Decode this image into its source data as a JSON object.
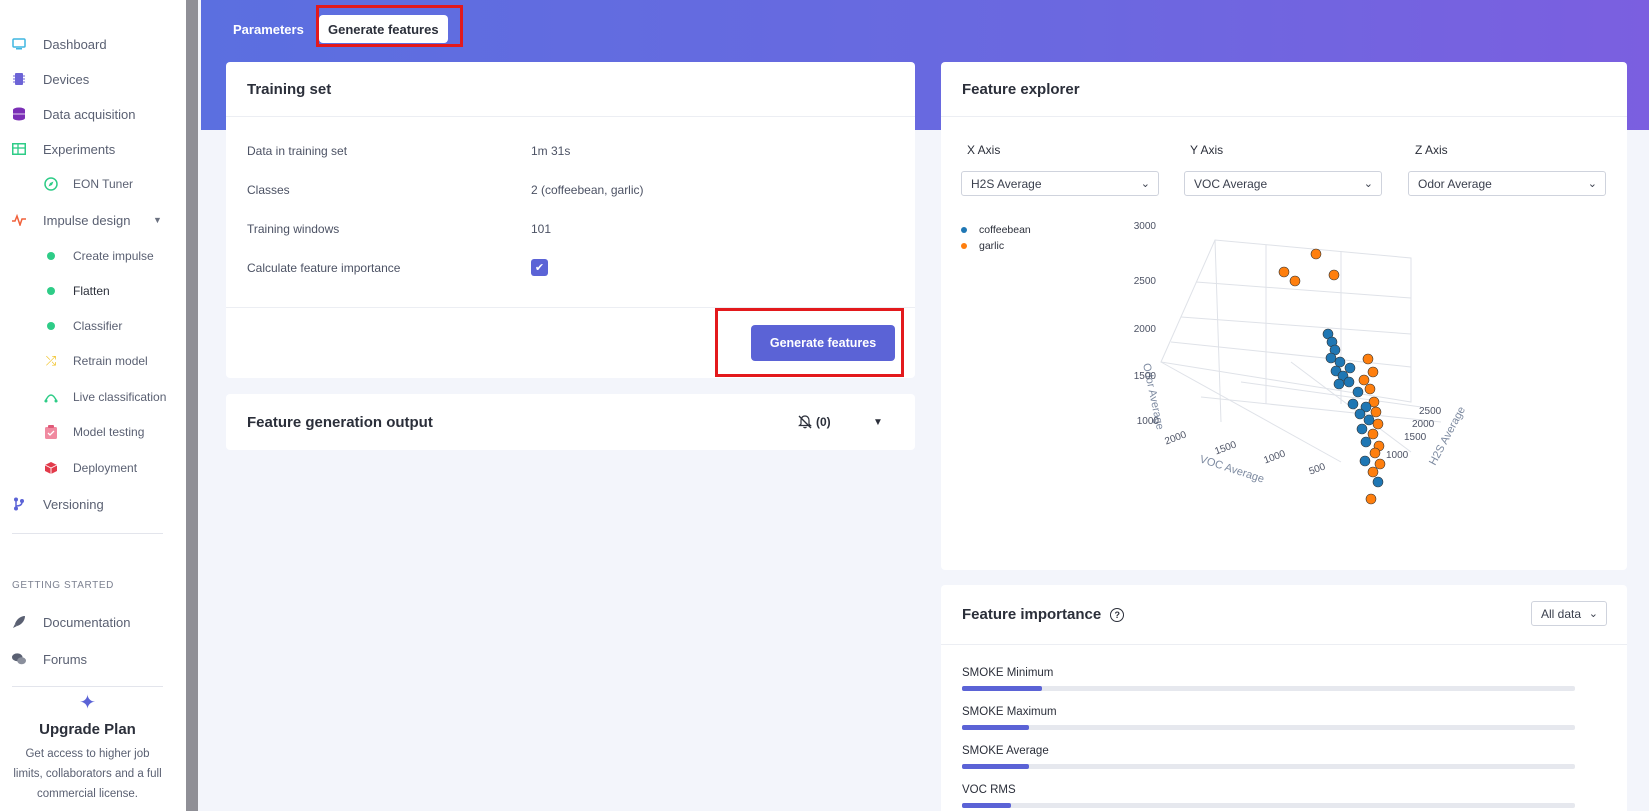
{
  "sidebar": {
    "items": [
      {
        "label": "Dashboard",
        "icon": "monitor-icon"
      },
      {
        "label": "Devices",
        "icon": "chip-icon"
      },
      {
        "label": "Data acquisition",
        "icon": "database-icon"
      },
      {
        "label": "Experiments",
        "icon": "table-icon"
      },
      {
        "label": "EON Tuner",
        "icon": "compass-icon"
      },
      {
        "label": "Impulse design",
        "icon": "pulse-icon"
      },
      {
        "label": "Create impulse",
        "icon": "dot-icon"
      },
      {
        "label": "Flatten",
        "icon": "dot-icon"
      },
      {
        "label": "Classifier",
        "icon": "dot-icon"
      },
      {
        "label": "Retrain model",
        "icon": "shuffle-icon"
      },
      {
        "label": "Live classification",
        "icon": "live-icon"
      },
      {
        "label": "Model testing",
        "icon": "clipboard-icon"
      },
      {
        "label": "Deployment",
        "icon": "cube-icon"
      },
      {
        "label": "Versioning",
        "icon": "branch-icon"
      }
    ],
    "getting_started_title": "GETTING STARTED",
    "getting_started": [
      {
        "label": "Documentation",
        "icon": "rocket-icon"
      },
      {
        "label": "Forums",
        "icon": "chat-icon"
      }
    ],
    "upgrade": {
      "title": "Upgrade Plan",
      "desc": "Get access to higher job limits, collaborators and a full commercial license."
    }
  },
  "tabs": {
    "parameters": "Parameters",
    "generate": "Generate features"
  },
  "training_set": {
    "title": "Training set",
    "rows": [
      {
        "label": "Data in training set",
        "value": "1m 31s"
      },
      {
        "label": "Classes",
        "value": "2 (coffeebean, garlic)"
      },
      {
        "label": "Training windows",
        "value": "101"
      },
      {
        "label": "Calculate feature importance",
        "value": ""
      }
    ],
    "button": "Generate features"
  },
  "output": {
    "title": "Feature generation output",
    "count": "(0)"
  },
  "explorer": {
    "title": "Feature explorer",
    "x_label": "X Axis",
    "y_label": "Y Axis",
    "z_label": "Z Axis",
    "x_value": "H2S Average",
    "y_value": "VOC Average",
    "z_value": "Odor Average",
    "legend": [
      {
        "name": "coffeebean",
        "color": "#1f77b4"
      },
      {
        "name": "garlic",
        "color": "#ff7f0e"
      }
    ],
    "z_axis_title": "Odor Average",
    "y_axis_title": "VOC Average",
    "x_axis_title": "H2S Average",
    "z_ticks": [
      "3000",
      "2500",
      "2000",
      "1500",
      "1000"
    ],
    "y_ticks": [
      "2000",
      "1500",
      "1000",
      "500"
    ],
    "x_ticks": [
      "2500",
      "2000",
      "1500",
      "1000"
    ]
  },
  "importance": {
    "title": "Feature importance",
    "filter": "All data",
    "features": [
      {
        "name": "SMOKE Minimum",
        "value": 0.13
      },
      {
        "name": "SMOKE Maximum",
        "value": 0.11
      },
      {
        "name": "SMOKE Average",
        "value": 0.11
      },
      {
        "name": "VOC RMS",
        "value": 0.08
      }
    ]
  }
}
